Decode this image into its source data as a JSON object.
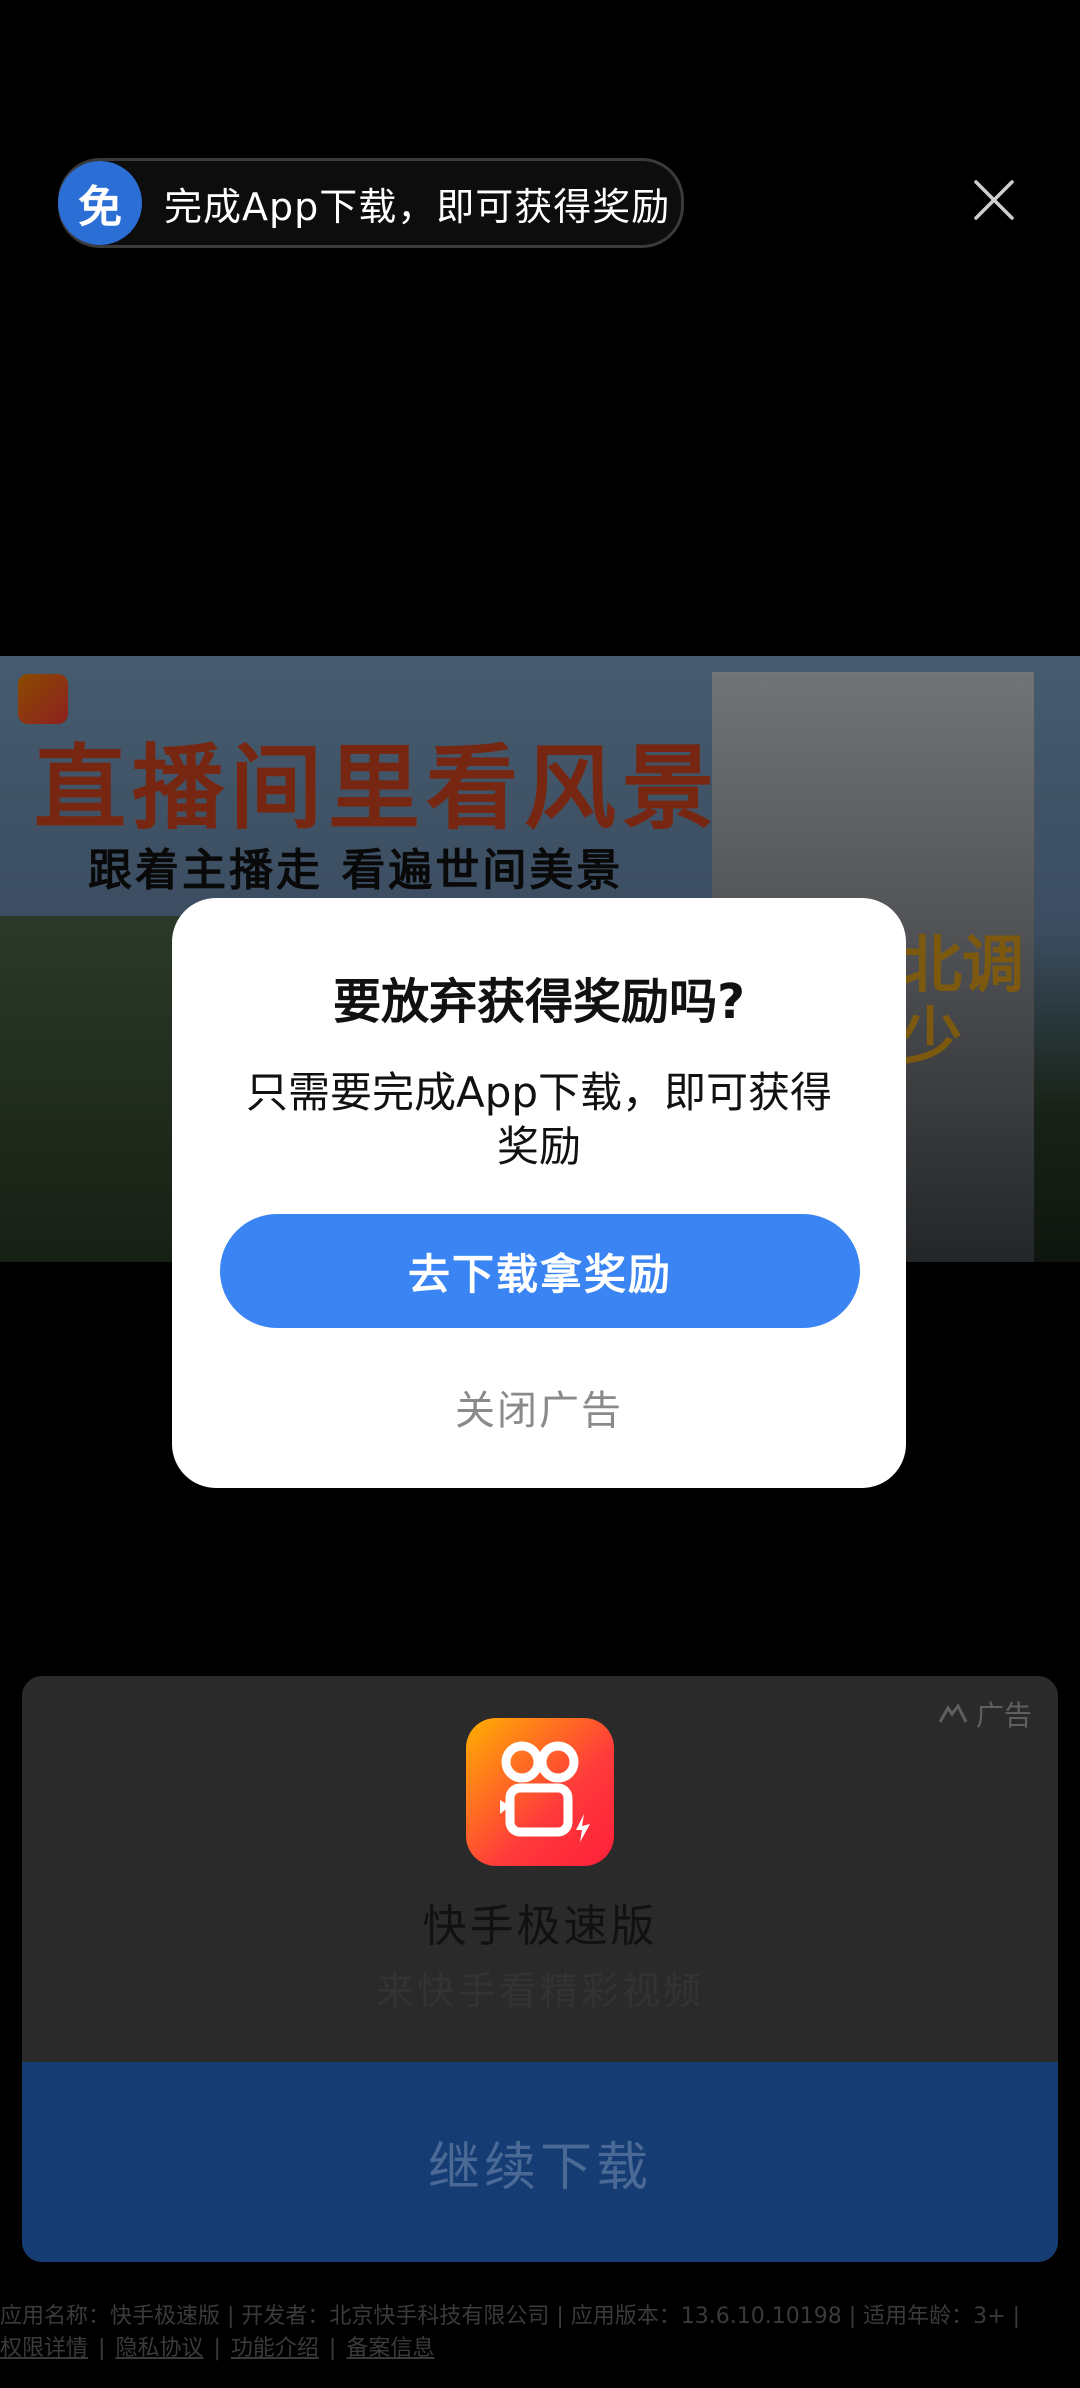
{
  "top_bar": {
    "badge": "免",
    "message": "完成App下载，即可获得奖励"
  },
  "banner": {
    "headline": "直播间里看风景",
    "subline": "跟着主播走   看遍世间美景",
    "photo_text_1": "北调",
    "photo_text_2": "少"
  },
  "dialog": {
    "title": "要放弃获得奖励吗?",
    "body": "只需要完成App下载，即可获得奖励",
    "primary_button": "去下载拿奖励",
    "secondary_button": "关闭广告"
  },
  "ad_card": {
    "ad_label": "广告",
    "app_name": "快手极速版",
    "app_desc": "来快手看精彩视频",
    "cta": "继续下载"
  },
  "footer": {
    "line1": "应用名称：快手极速版 | 开发者：北京快手科技有限公司 | 应用版本：13.6.10.10198 | 适用年龄：3+ |",
    "links": [
      "权限详情",
      "隐私协议",
      "功能介绍",
      "备案信息"
    ]
  },
  "colors": {
    "primary": "#3a85f3",
    "badge_blue": "#2b6fd6",
    "overlay": "#000000"
  }
}
